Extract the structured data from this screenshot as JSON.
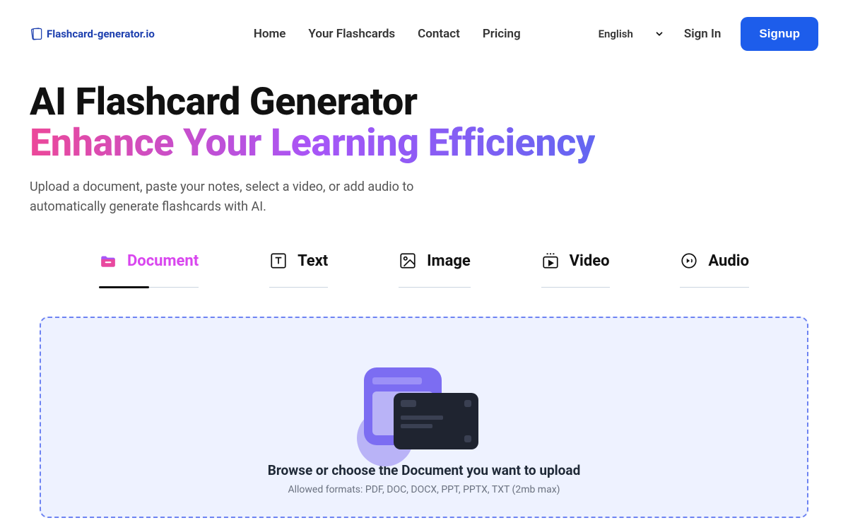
{
  "brand": {
    "name": "Flashcard-generator.io"
  },
  "nav": {
    "home": "Home",
    "flashcards": "Your Flashcards",
    "contact": "Contact",
    "pricing": "Pricing"
  },
  "header": {
    "language": "English",
    "signin": "Sign In",
    "signup": "Signup"
  },
  "hero": {
    "title": "AI Flashcard Generator",
    "subtitle": "Enhance Your Learning Efficiency",
    "description": "Upload a document, paste your notes, select a video, or add audio to automatically generate flashcards with AI."
  },
  "tabs": {
    "document": "Document",
    "text": "Text",
    "image": "Image",
    "video": "Video",
    "audio": "Audio"
  },
  "upload": {
    "title": "Browse or choose the Document you want to upload",
    "formats": "Allowed formats: PDF, DOC, DOCX, PPT, PPTX, TXT (2mb max)"
  }
}
